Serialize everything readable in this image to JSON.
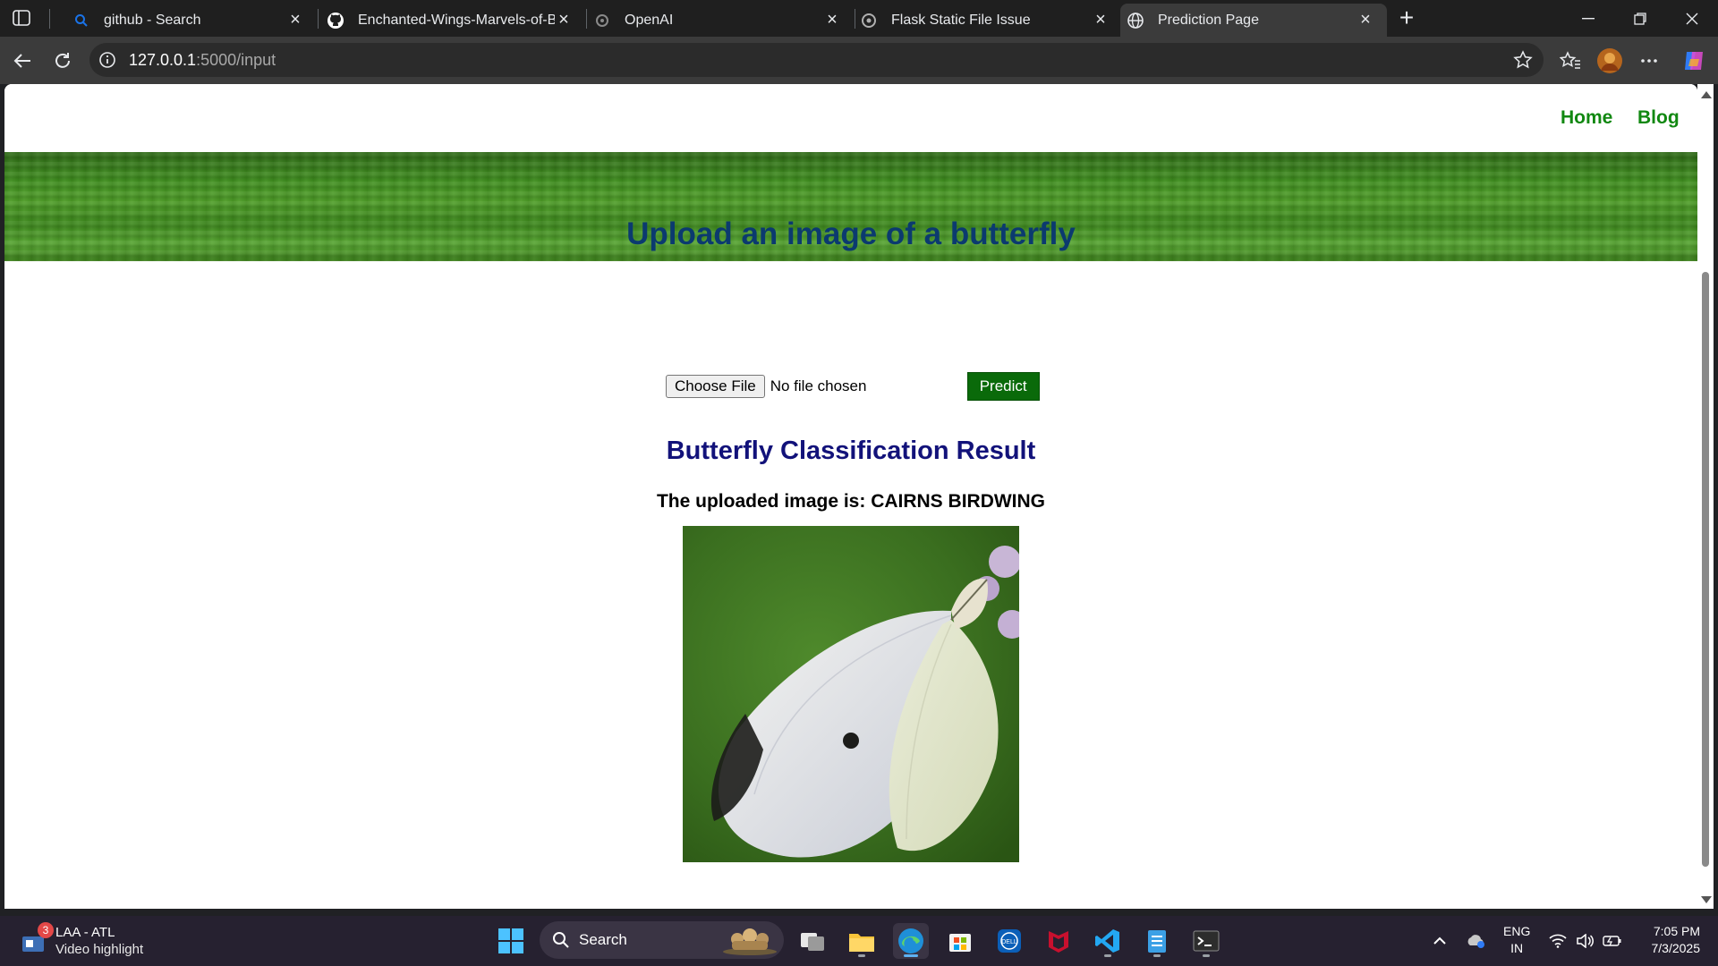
{
  "browser": {
    "tabs": [
      {
        "title": "github - Search",
        "active": false
      },
      {
        "title": "Enchanted-Wings-Marvels-of-But",
        "active": false
      },
      {
        "title": "OpenAI",
        "active": false
      },
      {
        "title": "Flask Static File Issue",
        "active": false
      },
      {
        "title": "Prediction Page",
        "active": true
      }
    ],
    "url_host": "127.0.0.1",
    "url_path": ":5000/input"
  },
  "site": {
    "nav": {
      "home": "Home",
      "blog": "Blog"
    },
    "upload_title": "Upload an image of a butterfly",
    "choose_file_label": "Choose File",
    "no_file_label": "No file chosen",
    "predict_label": "Predict",
    "result_title": "Butterfly Classification Result",
    "result_text": "The uploaded image is: CAIRNS BIRDWING",
    "colors": {
      "nav_link": "#118811",
      "title": "#0b3a6f",
      "result_title": "#12127a",
      "predict_bg": "#0a6a0a"
    }
  },
  "taskbar": {
    "widget_line1": "LAA - ATL",
    "widget_line2": "Video highlight",
    "widget_badge": "3",
    "search_label": "Search",
    "lang_line1": "ENG",
    "lang_line2": "IN",
    "time": "7:05 PM",
    "date": "7/3/2025"
  }
}
